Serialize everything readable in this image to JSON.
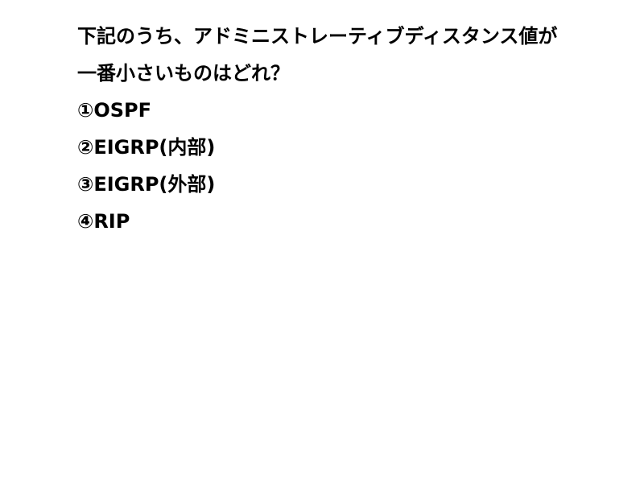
{
  "question": {
    "line1": "下記のうち、アドミニストレーティブディスタンス値が",
    "line2": "一番小さいものはどれ？"
  },
  "options": [
    "①OSPF",
    "②EIGRP(内部)",
    "③EIGRP(外部)",
    "④RIP"
  ]
}
